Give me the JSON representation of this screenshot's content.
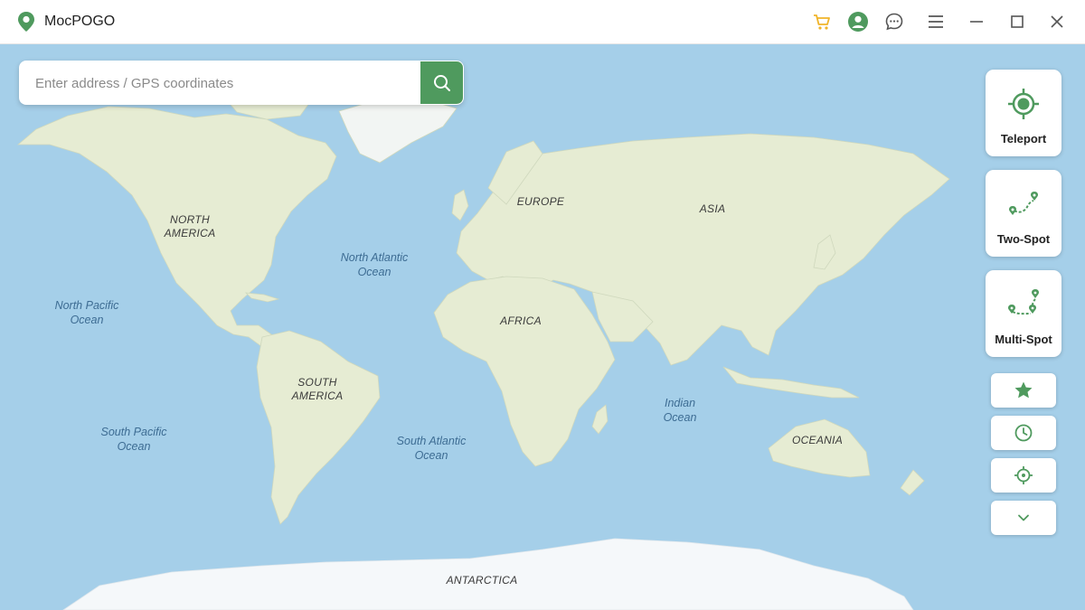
{
  "app": {
    "title": "MocPOGO"
  },
  "colors": {
    "accent": "#4f9a5e",
    "cart": "#f0b429",
    "ocean": "#a5cfe9",
    "land": "#e6ecd3",
    "ice": "#f4f7f9"
  },
  "titlebar": {
    "icons": [
      "cart-icon",
      "account-icon",
      "feedback-icon",
      "menu-icon",
      "minimize-icon",
      "maximize-icon",
      "close-icon"
    ]
  },
  "search": {
    "placeholder": "Enter address / GPS coordinates",
    "value": ""
  },
  "modes": [
    {
      "label": "Teleport",
      "icon": "teleport-target-icon"
    },
    {
      "label": "Two-Spot",
      "icon": "two-spot-route-icon"
    },
    {
      "label": "Multi-Spot",
      "icon": "multi-spot-route-icon"
    }
  ],
  "tools": [
    "favorites-star-icon",
    "history-clock-icon",
    "locate-crosshair-icon",
    "expand-chevron-icon"
  ],
  "map": {
    "continents": {
      "north_america": "NORTH\nAMERICA",
      "south_america": "SOUTH\nAMERICA",
      "europe": "EUROPE",
      "asia": "ASIA",
      "africa": "AFRICA",
      "oceania": "OCEANIA",
      "antarctica": "ANTARCTICA"
    },
    "oceans": {
      "north_pacific": "North Pacific\nOcean",
      "north_atlantic": "North Atlantic\nOcean",
      "south_pacific": "South Pacific\nOcean",
      "south_atlantic": "South Atlantic\nOcean",
      "indian": "Indian\nOcean"
    }
  }
}
